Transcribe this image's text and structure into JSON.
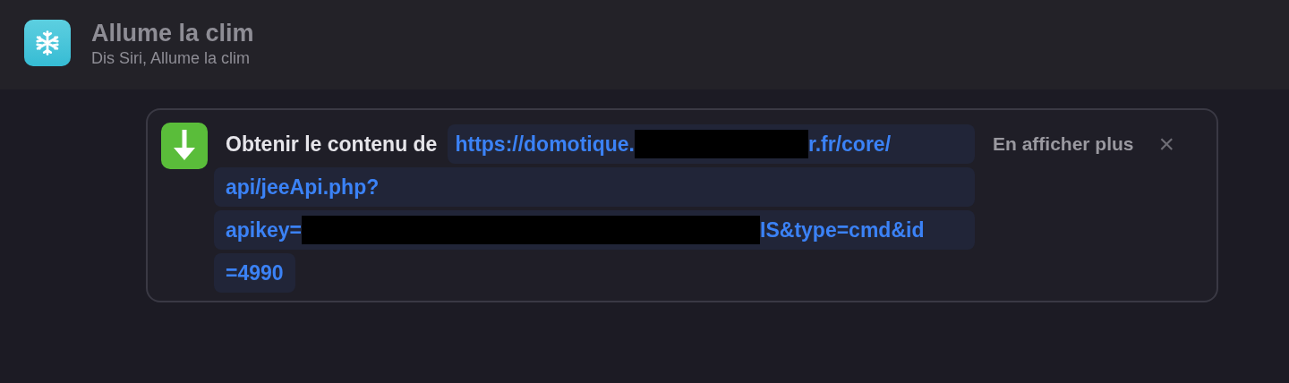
{
  "header": {
    "title": "Allume la clim",
    "subtitle": "Dis Siri, Allume la clim"
  },
  "action": {
    "label": "Obtenir le contenu de",
    "more": "En afficher plus",
    "close": "×",
    "url_lines": [
      {
        "segments": [
          {
            "kind": "text",
            "text": "https://domotique."
          },
          {
            "kind": "redacted"
          },
          {
            "kind": "text",
            "text": "r.fr/core/"
          }
        ]
      },
      {
        "segments": [
          {
            "kind": "text",
            "text": "api/jeeApi.php?"
          }
        ]
      },
      {
        "segments": [
          {
            "kind": "text",
            "text": "apikey="
          },
          {
            "kind": "redacted"
          },
          {
            "kind": "text",
            "text": "IS&type=cmd&id"
          }
        ]
      },
      {
        "segments": [
          {
            "kind": "text",
            "text": "=4990"
          }
        ]
      }
    ]
  }
}
